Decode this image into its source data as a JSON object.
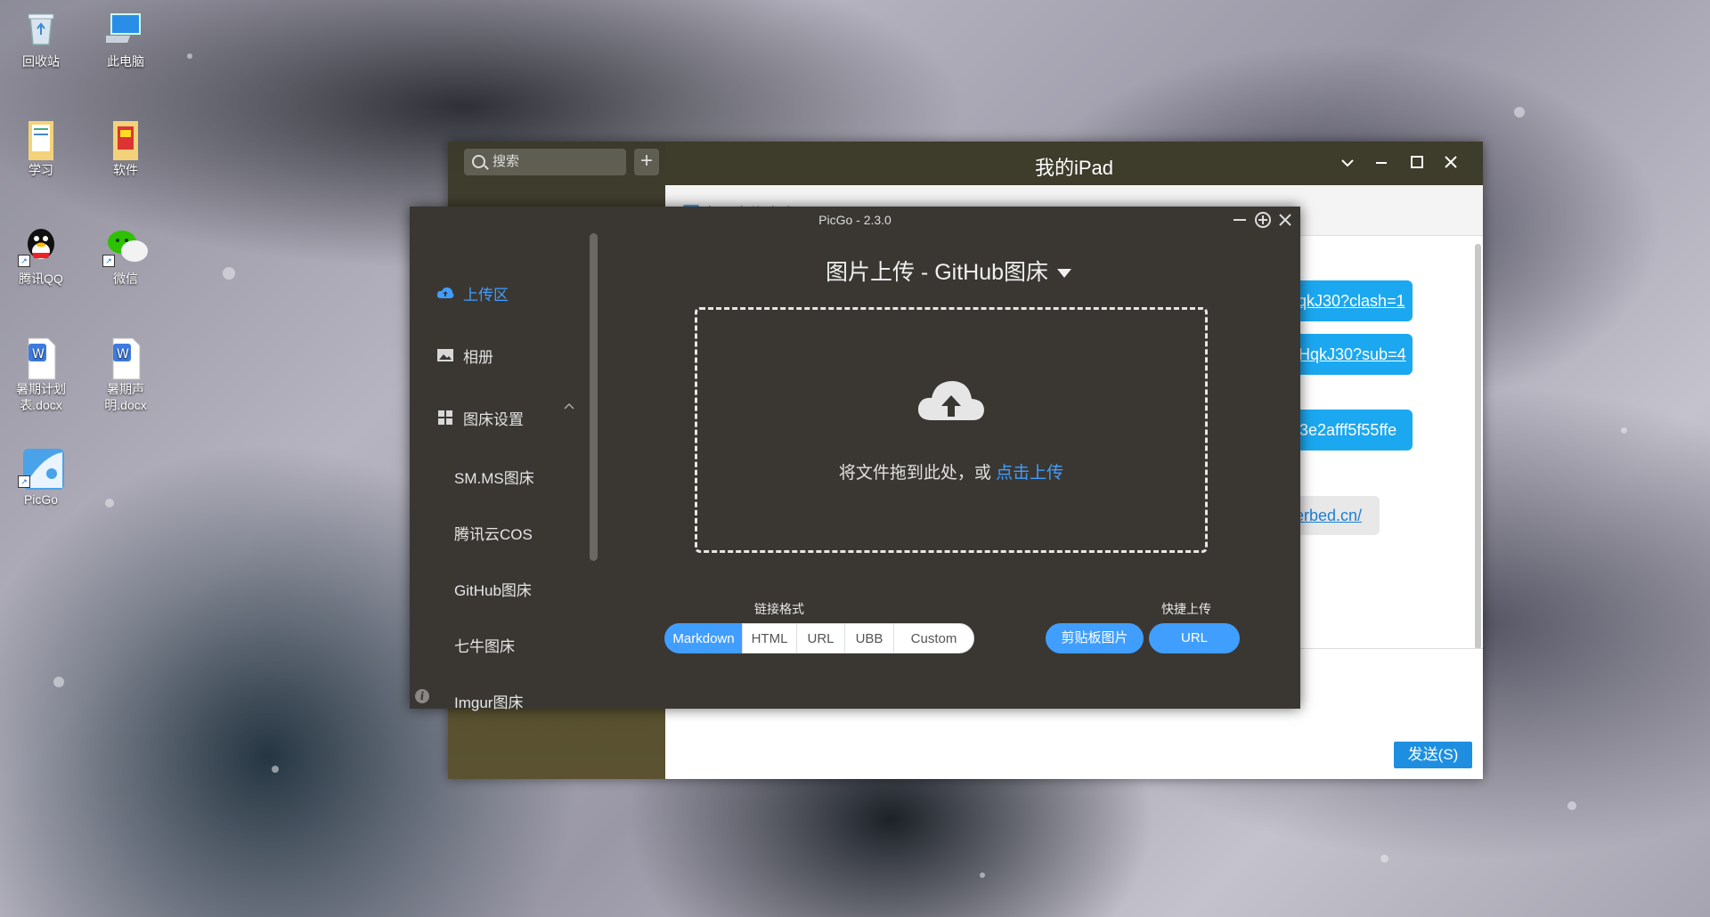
{
  "desktop": {
    "icons": [
      {
        "label": "回收站"
      },
      {
        "label": "此电脑"
      },
      {
        "label": "学习"
      },
      {
        "label": "软件"
      },
      {
        "label": "腾讯QQ"
      },
      {
        "label": "微信"
      },
      {
        "label": "暑期计划表.docx"
      },
      {
        "label": "暑期声明.docx"
      },
      {
        "label": "PicGo"
      }
    ]
  },
  "ipad_window": {
    "title": "我的iPad",
    "search_placeholder": "搜索",
    "add_symbol": "+",
    "subheader": "打开文件助手",
    "messages": [
      {
        "text": "HqkJ30?clash=1"
      },
      {
        "text": "GHqkJ30?sub=4"
      },
      {
        "text": "9f3e2afff5f55ffe"
      },
      {
        "text": "perbed.cn/"
      }
    ],
    "send_label": "发送(S)"
  },
  "picgo": {
    "title": "PicGo - 2.3.0",
    "nav": [
      {
        "label": "上传区",
        "icon": "cloud-upload-icon",
        "active": true
      },
      {
        "label": "相册",
        "icon": "image-icon"
      },
      {
        "label": "图床设置",
        "icon": "grid-icon"
      }
    ],
    "sub_nav": [
      "SM.MS图床",
      "腾讯云COS",
      "GitHub图床",
      "七牛图床",
      "Imgur图床"
    ],
    "heading": "图片上传 - GitHub图床",
    "drop_text": "将文件拖到此处，或 ",
    "drop_link": "点击上传",
    "link_format_label": "链接格式",
    "link_formats": [
      "Markdown",
      "HTML",
      "URL",
      "UBB",
      "Custom"
    ],
    "selected_format": "Markdown",
    "quick_upload_label": "快捷上传",
    "quick_upload": [
      "剪贴板图片",
      "URL"
    ],
    "accent": "#409eff"
  }
}
